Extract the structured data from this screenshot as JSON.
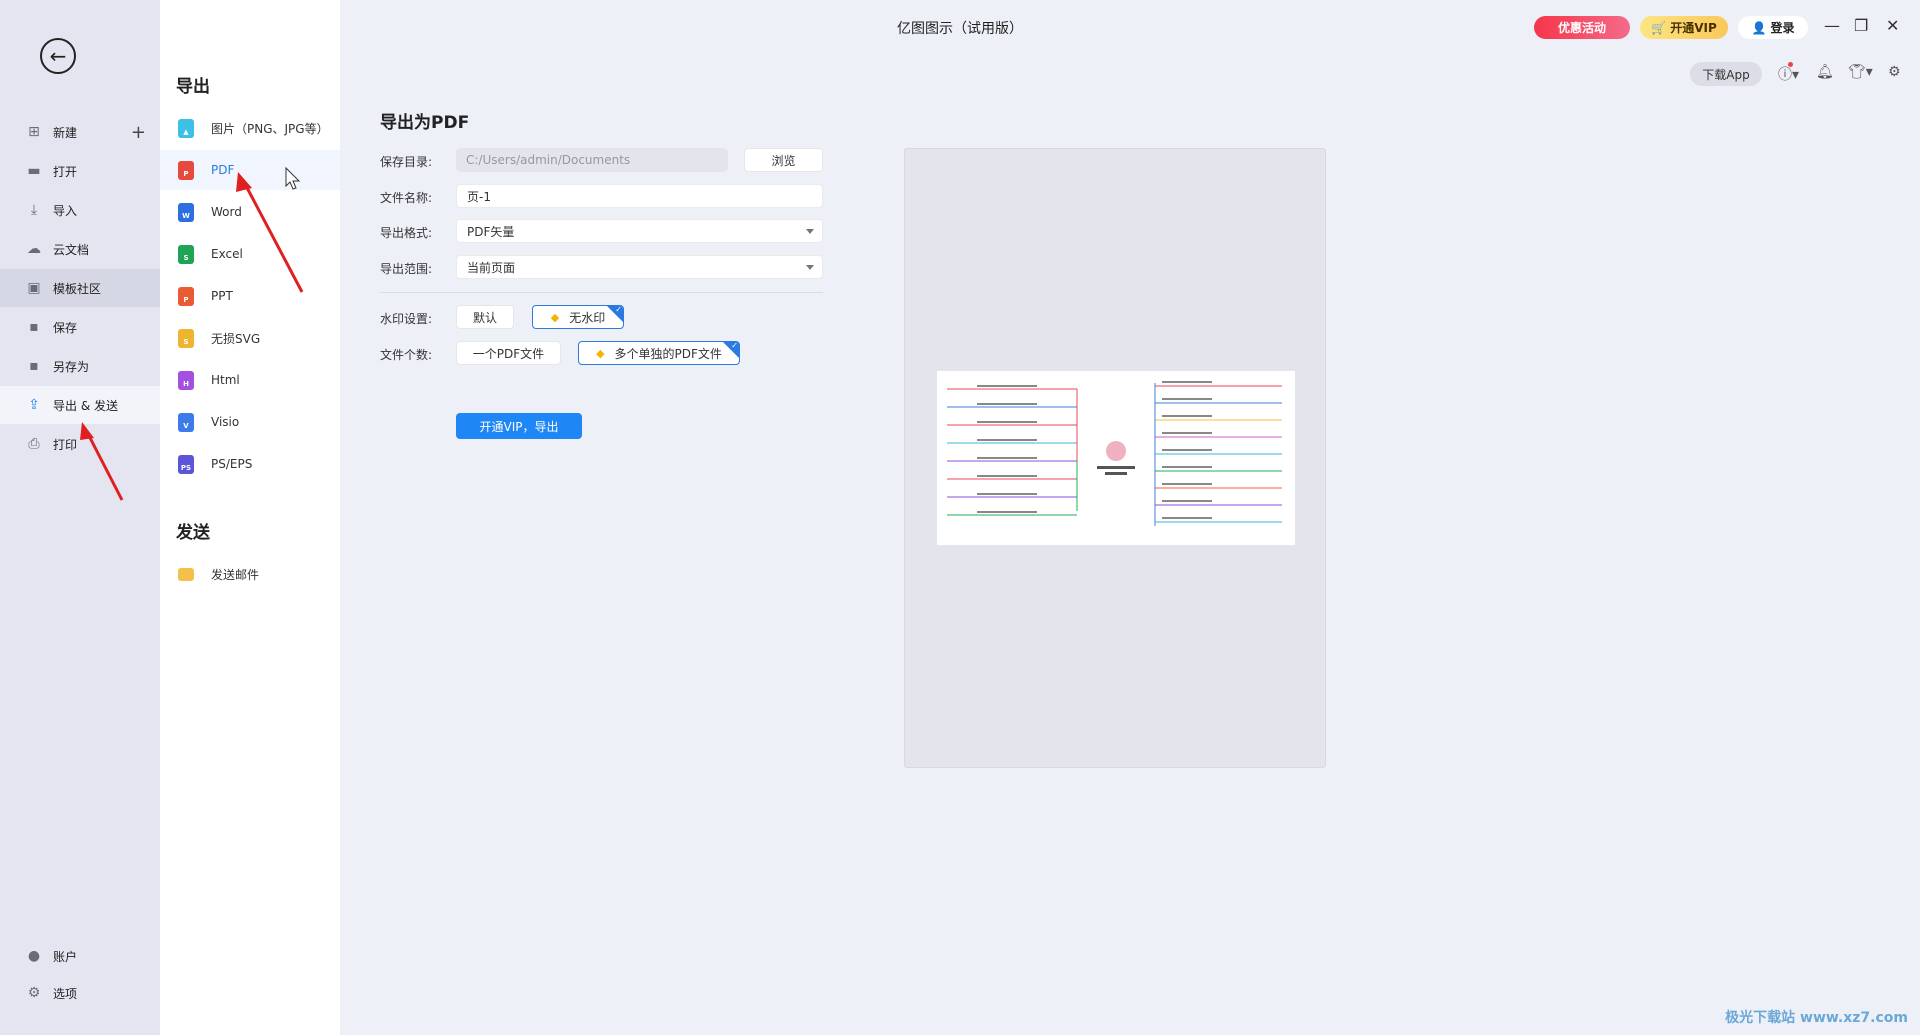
{
  "window": {
    "title": "亿图图示（试用版）",
    "promo": "优惠活动",
    "vip": "开通VIP",
    "login": "登录",
    "download_app": "下载App"
  },
  "sidebar": {
    "items": [
      {
        "label": "新建",
        "icon": "plus-square-icon"
      },
      {
        "label": "打开",
        "icon": "folder-icon"
      },
      {
        "label": "导入",
        "icon": "import-icon"
      },
      {
        "label": "云文档",
        "icon": "cloud-icon"
      },
      {
        "label": "模板社区",
        "icon": "community-icon"
      },
      {
        "label": "保存",
        "icon": "save-icon"
      },
      {
        "label": "另存为",
        "icon": "save-as-icon"
      },
      {
        "label": "导出 & 发送",
        "icon": "export-icon"
      },
      {
        "label": "打印",
        "icon": "print-icon"
      }
    ],
    "bottom": [
      {
        "label": "账户",
        "icon": "account-icon"
      },
      {
        "label": "选项",
        "icon": "gear-icon"
      }
    ]
  },
  "panel": {
    "export_heading": "导出",
    "export_items": [
      {
        "label": "图片（PNG、JPG等）",
        "color": "#3cc0e6",
        "glyph": "▲"
      },
      {
        "label": "PDF",
        "color": "#e8493f",
        "glyph": "P"
      },
      {
        "label": "Word",
        "color": "#2d6fe0",
        "glyph": "W"
      },
      {
        "label": "Excel",
        "color": "#1fa456",
        "glyph": "S"
      },
      {
        "label": "PPT",
        "color": "#ea5a33",
        "glyph": "P"
      },
      {
        "label": "无损SVG",
        "color": "#f0b530",
        "glyph": "S"
      },
      {
        "label": "Html",
        "color": "#a54fe0",
        "glyph": "H"
      },
      {
        "label": "Visio",
        "color": "#3d7be8",
        "glyph": "V"
      },
      {
        "label": "PS/EPS",
        "color": "#5b56d8",
        "glyph": "PS"
      }
    ],
    "send_heading": "发送",
    "send_items": [
      {
        "label": "发送邮件",
        "color": "#f5c04a"
      }
    ]
  },
  "form": {
    "title": "导出为PDF",
    "save_dir_label": "保存目录:",
    "save_dir": "C:/Users/admin/Documents",
    "browse": "浏览",
    "filename_label": "文件名称:",
    "filename": "页-1",
    "format_label": "导出格式:",
    "format": "PDF矢量",
    "range_label": "导出范围:",
    "range": "当前页面",
    "watermark_label": "水印设置:",
    "watermark_options": [
      "默认",
      "无水印"
    ],
    "watermark_selected": "无水印",
    "count_label": "文件个数:",
    "count_options": [
      "一个PDF文件",
      "多个单独的PDF文件"
    ],
    "count_selected": "多个单独的PDF文件",
    "export_button": "开通VIP，导出"
  },
  "watermark_site": "极光下载站"
}
